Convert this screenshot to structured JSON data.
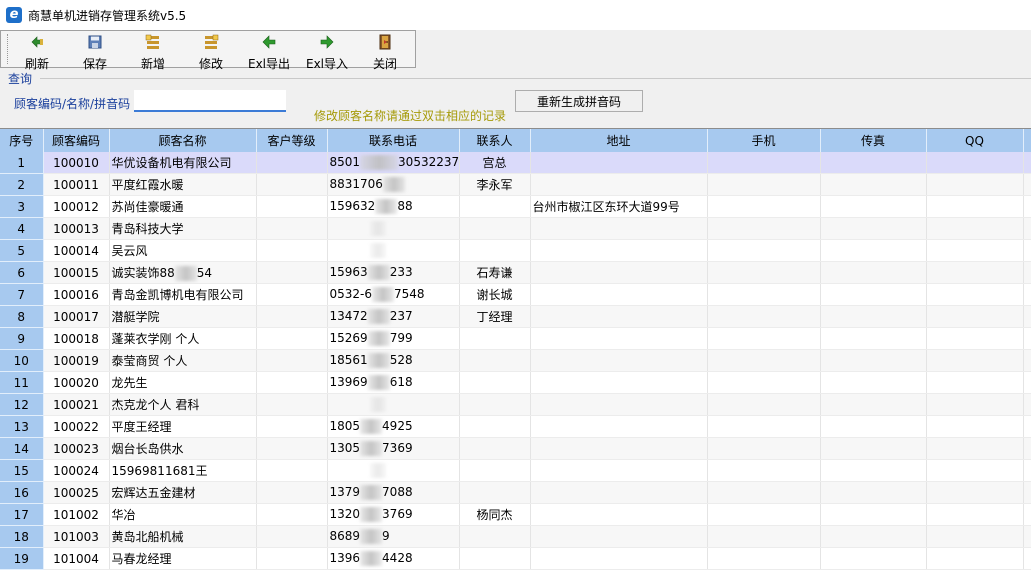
{
  "window": {
    "title": "商慧单机进销存管理系统v5.5",
    "icon": "app-e-icon"
  },
  "toolbar": {
    "buttons": [
      {
        "label": "刷新",
        "icon": "refresh-icon"
      },
      {
        "label": "保存",
        "icon": "save-icon"
      },
      {
        "label": "新增",
        "icon": "add-icon"
      },
      {
        "label": "修改",
        "icon": "edit-icon"
      },
      {
        "label": "Exl导出",
        "icon": "excel-export-icon"
      },
      {
        "label": "Exl导入",
        "icon": "excel-import-icon"
      },
      {
        "label": "关闭",
        "icon": "close-door-icon"
      }
    ]
  },
  "query": {
    "group_label": "查询",
    "search_label": "顾客编码/名称/拼音码",
    "search_value": "",
    "hint": "修改顾客名称请通过双击相应的记录",
    "regen_button": "重新生成拼音码"
  },
  "grid": {
    "columns": [
      "序号",
      "顾客编码",
      "顾客名称",
      "客户等级",
      "联系电话",
      "联系人",
      "地址",
      "手机",
      "传真",
      "QQ"
    ],
    "rows": [
      {
        "idx": "1",
        "code": "100010",
        "name": "华优设备机电有限公司",
        "level": "",
        "phone": [
          "8501",
          "30532237("
        ],
        "contact": "宫总",
        "address": ""
      },
      {
        "idx": "2",
        "code": "100011",
        "name": "平度红霞水暖",
        "level": "",
        "phone": [
          "8831706",
          ""
        ],
        "contact": "李永军",
        "address": ""
      },
      {
        "idx": "3",
        "code": "100012",
        "name": "苏尚佳豪暖通",
        "level": "",
        "phone": [
          "159632",
          "88"
        ],
        "contact": "",
        "address": "台州市椒江区东环大道99号"
      },
      {
        "idx": "4",
        "code": "100013",
        "name": "青岛科技大学",
        "level": "",
        "phone": [
          "",
          ""
        ],
        "contact": "",
        "address": ""
      },
      {
        "idx": "5",
        "code": "100014",
        "name": "吴云风",
        "level": "",
        "phone": [
          "",
          ""
        ],
        "contact": "",
        "address": ""
      },
      {
        "idx": "6",
        "code": "100015",
        "name": [
          "诚实装饰88",
          "54"
        ],
        "level": "",
        "phone": [
          "15963",
          "233"
        ],
        "contact": "石寿谦",
        "address": ""
      },
      {
        "idx": "7",
        "code": "100016",
        "name": "青岛金凯博机电有限公司",
        "level": "",
        "phone": [
          "0532-6",
          "7548"
        ],
        "contact": "谢长城",
        "address": ""
      },
      {
        "idx": "8",
        "code": "100017",
        "name": "潜艇学院",
        "level": "",
        "phone": [
          "13472",
          "237"
        ],
        "contact": "丁经理",
        "address": ""
      },
      {
        "idx": "9",
        "code": "100018",
        "name": "蓬莱衣学刚 个人",
        "level": "",
        "phone": [
          "15269",
          "799"
        ],
        "contact": "",
        "address": ""
      },
      {
        "idx": "10",
        "code": "100019",
        "name": "泰莹商贸 个人",
        "level": "",
        "phone": [
          "18561",
          "528"
        ],
        "contact": "",
        "address": ""
      },
      {
        "idx": "11",
        "code": "100020",
        "name": "龙先生",
        "level": "",
        "phone": [
          "13969",
          "618"
        ],
        "contact": "",
        "address": ""
      },
      {
        "idx": "12",
        "code": "100021",
        "name": "杰克龙个人 君科",
        "level": "",
        "phone": [
          "",
          ""
        ],
        "contact": "",
        "address": ""
      },
      {
        "idx": "13",
        "code": "100022",
        "name": "平度王经理",
        "level": "",
        "phone": [
          "1805",
          "4925"
        ],
        "contact": "",
        "address": ""
      },
      {
        "idx": "14",
        "code": "100023",
        "name": "烟台长岛供水",
        "level": "",
        "phone": [
          "1305",
          "7369"
        ],
        "contact": "",
        "address": ""
      },
      {
        "idx": "15",
        "code": "100024",
        "name": "15969811681王",
        "level": "",
        "phone": [
          "",
          ""
        ],
        "contact": "",
        "address": ""
      },
      {
        "idx": "16",
        "code": "100025",
        "name": "宏辉达五金建材",
        "level": "",
        "phone": [
          "1379",
          "7088"
        ],
        "contact": "",
        "address": ""
      },
      {
        "idx": "17",
        "code": "101002",
        "name": "华冶",
        "level": "",
        "phone": [
          "1320",
          "3769"
        ],
        "contact": "杨同杰",
        "address": ""
      },
      {
        "idx": "18",
        "code": "101003",
        "name": "黄岛北船机械",
        "level": "",
        "phone": [
          "8689",
          "9"
        ],
        "contact": "",
        "address": ""
      },
      {
        "idx": "19",
        "code": "101004",
        "name": "马春龙经理",
        "level": "",
        "phone": [
          "1396",
          "4428"
        ],
        "contact": "",
        "address": ""
      }
    ]
  }
}
